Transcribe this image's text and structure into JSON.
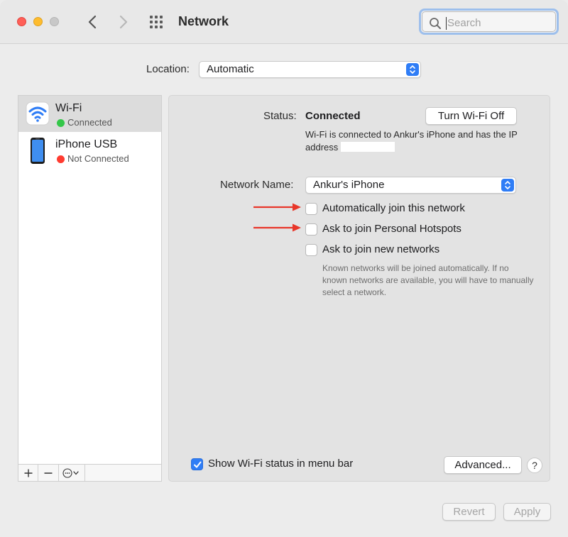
{
  "toolbar": {
    "title": "Network",
    "search_placeholder": "Search",
    "back_icon": "chevron-left-icon",
    "forward_icon": "chevron-right-icon",
    "grid_icon": "grid-icon"
  },
  "location": {
    "label": "Location:",
    "value": "Automatic"
  },
  "sidebar": {
    "items": [
      {
        "name": "Wi-Fi",
        "status": "Connected",
        "status_color": "#34c749",
        "icon": "wifi-icon"
      },
      {
        "name": "iPhone USB",
        "status": "Not Connected",
        "status_color": "#ff3b30",
        "icon": "iphone-icon"
      }
    ],
    "footer": {
      "add": "+",
      "remove": "−",
      "action": "⊙⌄"
    }
  },
  "panel": {
    "status_label": "Status:",
    "status_value": "Connected",
    "turn_off_label": "Turn Wi-Fi Off",
    "status_desc": "Wi-Fi is connected to Ankur's iPhone and has the IP address",
    "network_name_label": "Network Name:",
    "network_name_value": "Ankur's iPhone",
    "auto_join_label": "Automatically join this network",
    "hotspot_label": "Ask to join Personal Hotspots",
    "new_networks_label": "Ask to join new networks",
    "hint": "Known networks will be joined automatically. If no known networks are available, you will have to manually select a network.",
    "menubar_label": "Show Wi-Fi status in menu bar",
    "advanced_label": "Advanced...",
    "help_label": "?"
  },
  "bottom": {
    "revert_label": "Revert",
    "apply_label": "Apply"
  },
  "colors": {
    "accent": "#2f7df6",
    "annotation_arrow": "#e8372a"
  }
}
